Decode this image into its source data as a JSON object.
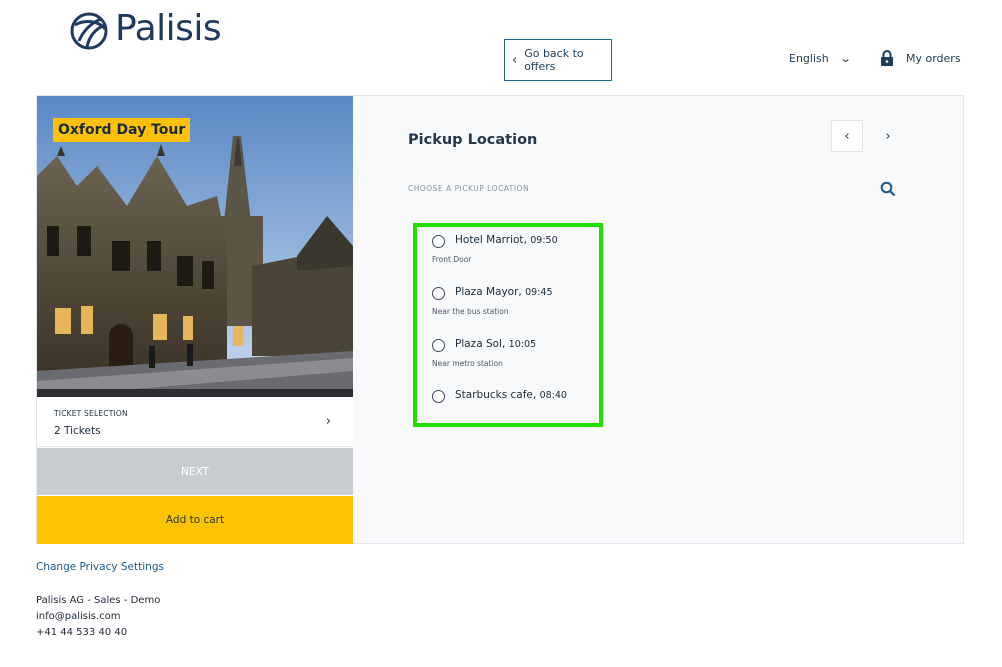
{
  "header": {
    "brand": "Palisis",
    "back_label": "Go back to offers",
    "language": "English",
    "orders_label": "My orders"
  },
  "tour": {
    "title": "Oxford Day Tour",
    "ticket_selection_label": "TICKET SELECTION",
    "ticket_selection_value": "2 Tickets",
    "next_label": "NEXT",
    "cart_label": "Add to cart"
  },
  "pickup": {
    "title": "Pickup Location",
    "choose_label": "CHOOSE A PICKUP LOCATION",
    "locations": [
      {
        "name": "Hotel Marriot",
        "time": "09:50",
        "note": "Front Door"
      },
      {
        "name": "Plaza Mayor",
        "time": "09:45",
        "note": "Near the bus station"
      },
      {
        "name": "Plaza Sol",
        "time": "10:05",
        "note": "Near metro station"
      },
      {
        "name": "Starbucks cafe",
        "time": "08:40",
        "note": ""
      }
    ]
  },
  "footer": {
    "privacy": "Change Privacy Settings",
    "company": "Palisis AG - Sales - Demo",
    "email": "info@palisis.com",
    "phone": "+41 44 533 40 40"
  },
  "colors": {
    "accent_yellow": "#ffc400",
    "highlight_green": "#22dd00",
    "navy": "#1f3a5f"
  },
  "icons": [
    "palisis-logo-icon",
    "chevron-left-icon",
    "chevron-down-icon",
    "lock-icon",
    "chevron-right-icon",
    "search-icon"
  ]
}
